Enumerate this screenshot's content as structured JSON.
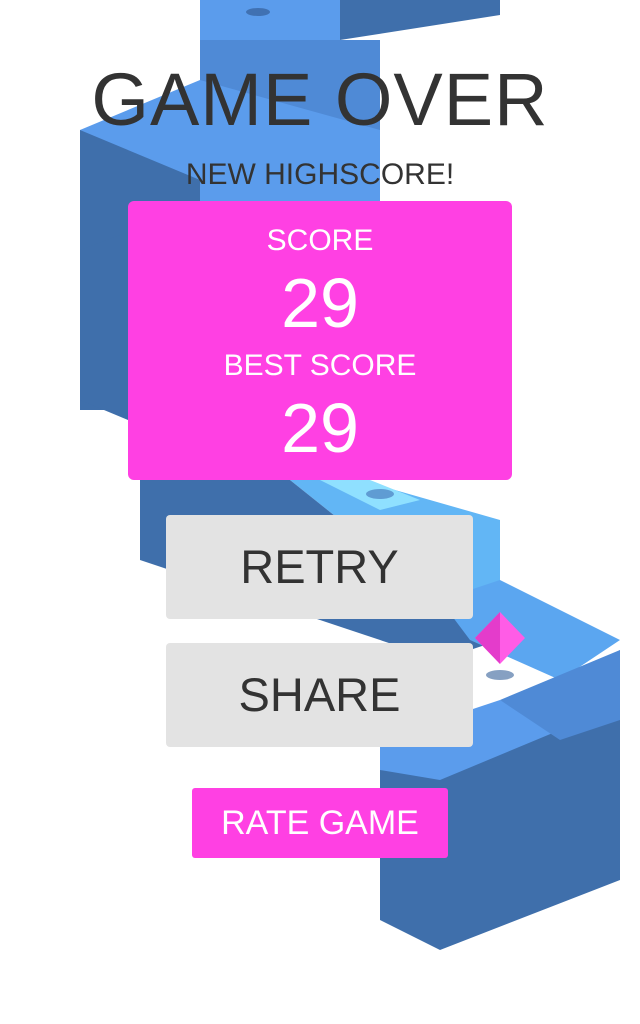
{
  "colors": {
    "accent": "#ff40e3",
    "button_bg": "#e3e3e3",
    "text_dark": "#333333",
    "zigzag_light": "#5b9cec",
    "zigzag_dark": "#3f6fab"
  },
  "game_over": {
    "title": "GAME OVER",
    "subtitle": "NEW HIGHSCORE!"
  },
  "score_panel": {
    "score_label": "SCORE",
    "score_value": "29",
    "best_label": "BEST SCORE",
    "best_value": "29"
  },
  "buttons": {
    "retry": "RETRY",
    "share": "SHARE",
    "rate": "RATE GAME"
  },
  "background": {
    "path_icon": "zigzag-path",
    "gem_icon": "pink-gem"
  }
}
